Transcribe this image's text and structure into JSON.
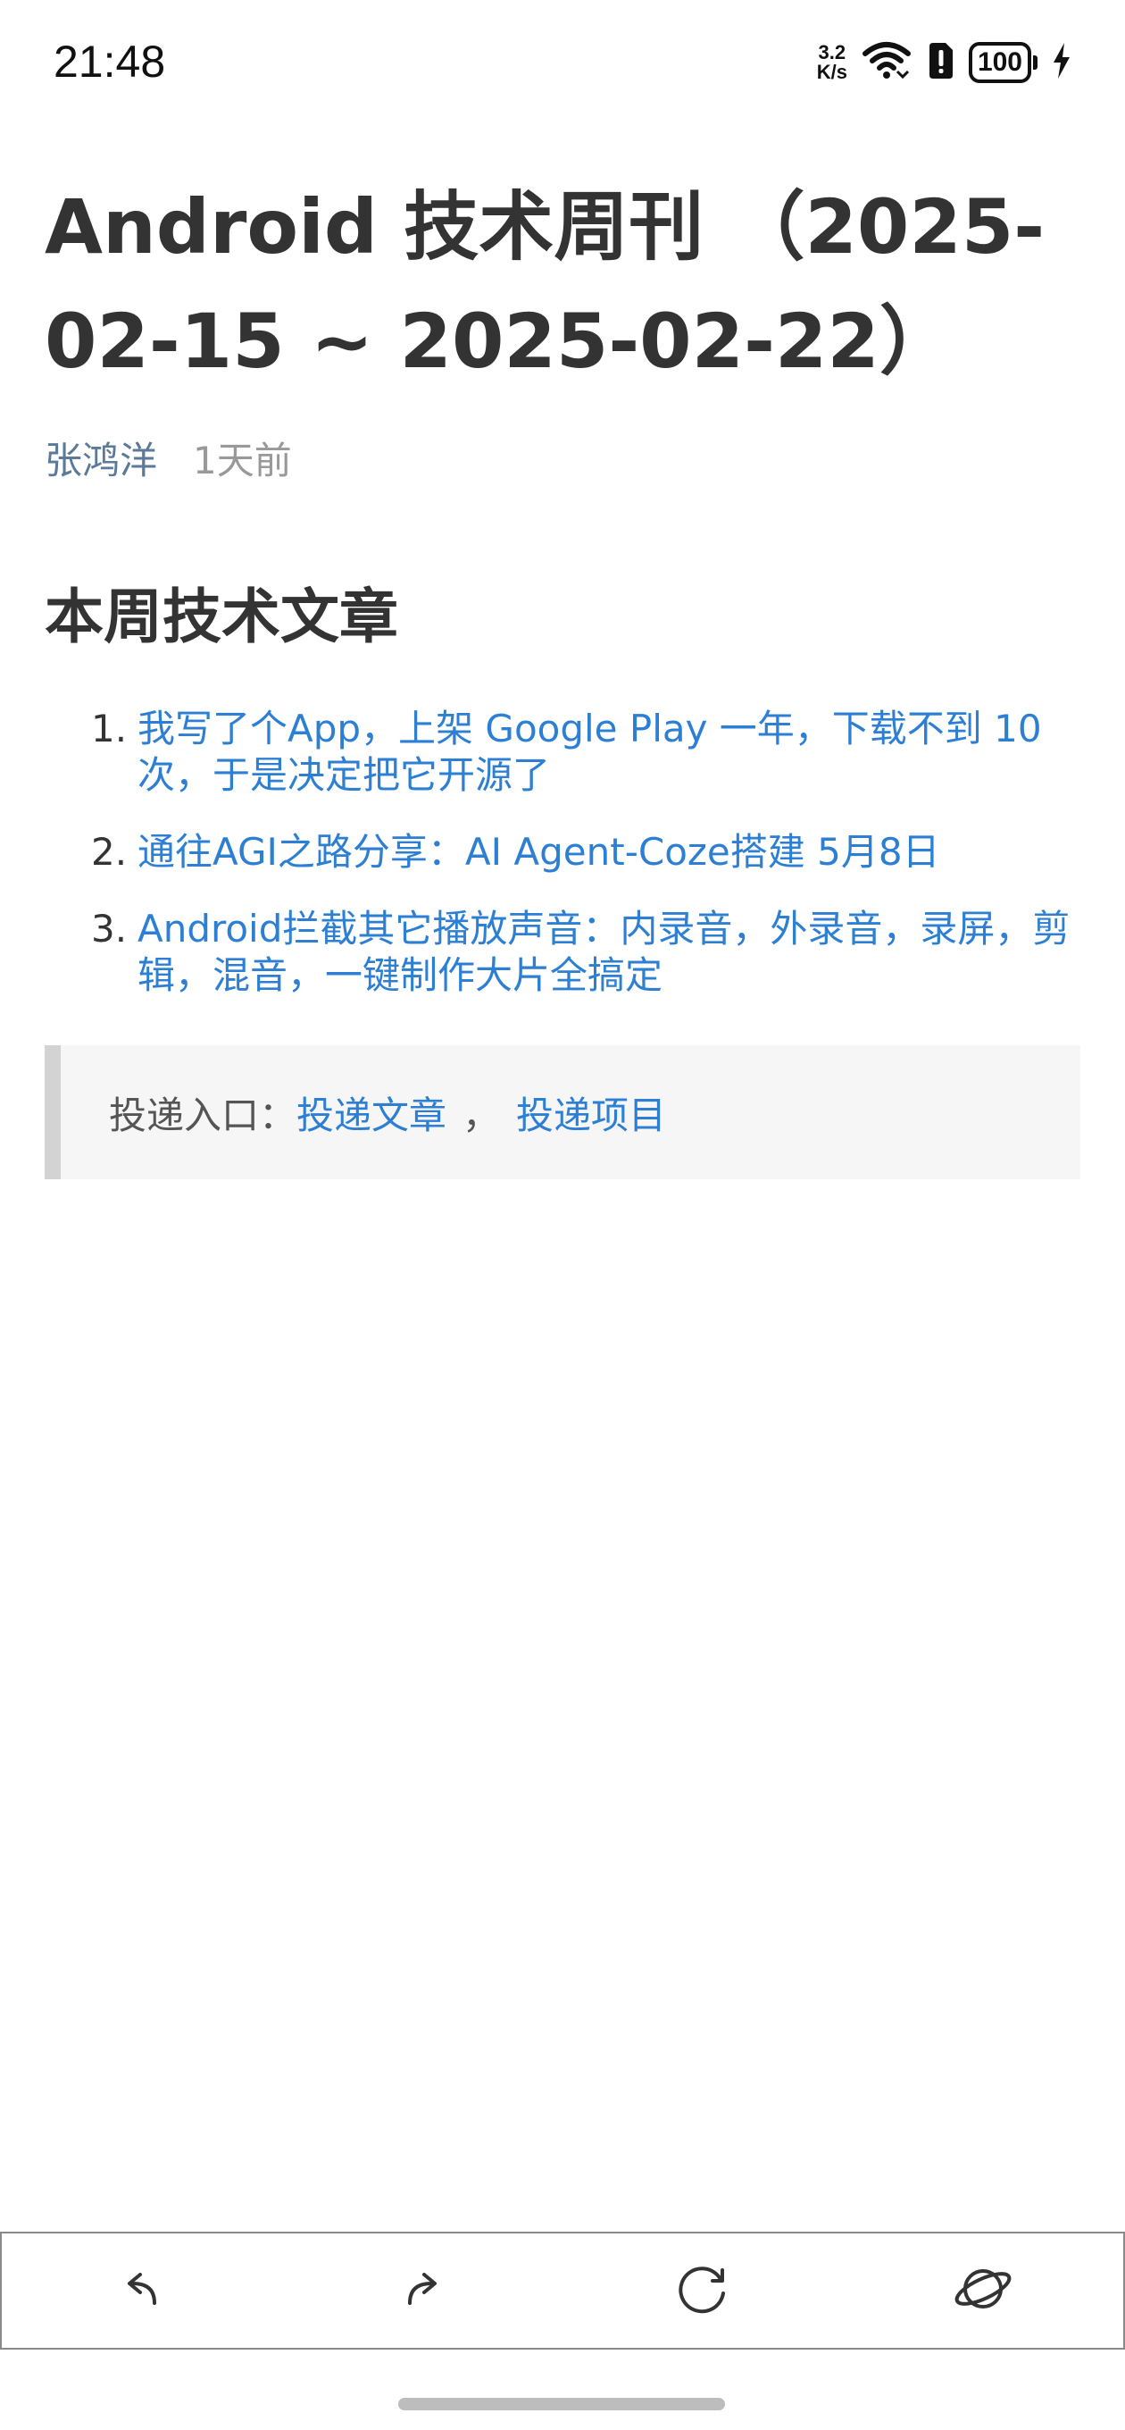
{
  "status_bar": {
    "time": "21:48",
    "net_speed_value": "3.2",
    "net_speed_unit": "K/s",
    "battery_level": "100"
  },
  "article": {
    "title": "Android 技术周刊 （2025-02-15 ~ 2025-02-22）",
    "author": "张鸿洋",
    "published": "1天前",
    "section_title": "本周技术文章",
    "items": [
      {
        "number": "1.",
        "title": "我写了个App，上架 Google Play 一年，下载不到 10 次，于是决定把它开源了"
      },
      {
        "number": "2.",
        "title": "通往AGI之路分享：AI Agent-Coze搭建 5月8日"
      },
      {
        "number": "3.",
        "title": "Android拦截其它播放声音：内录音，外录音，录屏，剪辑，混音，一键制作大片全搞定"
      }
    ],
    "submission": {
      "label": "投递入口：",
      "article_link": "投递文章",
      "separator": "，",
      "project_link": "投递项目"
    }
  },
  "toolbar": {
    "back_icon": "back-arrow-icon",
    "forward_icon": "forward-arrow-icon",
    "refresh_icon": "refresh-icon",
    "browser_icon": "planet-icon"
  },
  "colors": {
    "link": "#2d7fd3",
    "author": "#5b7a9a",
    "text": "#333333",
    "muted": "#999999",
    "quote_bg": "#f6f6f6",
    "quote_border": "#d3d3d3"
  }
}
